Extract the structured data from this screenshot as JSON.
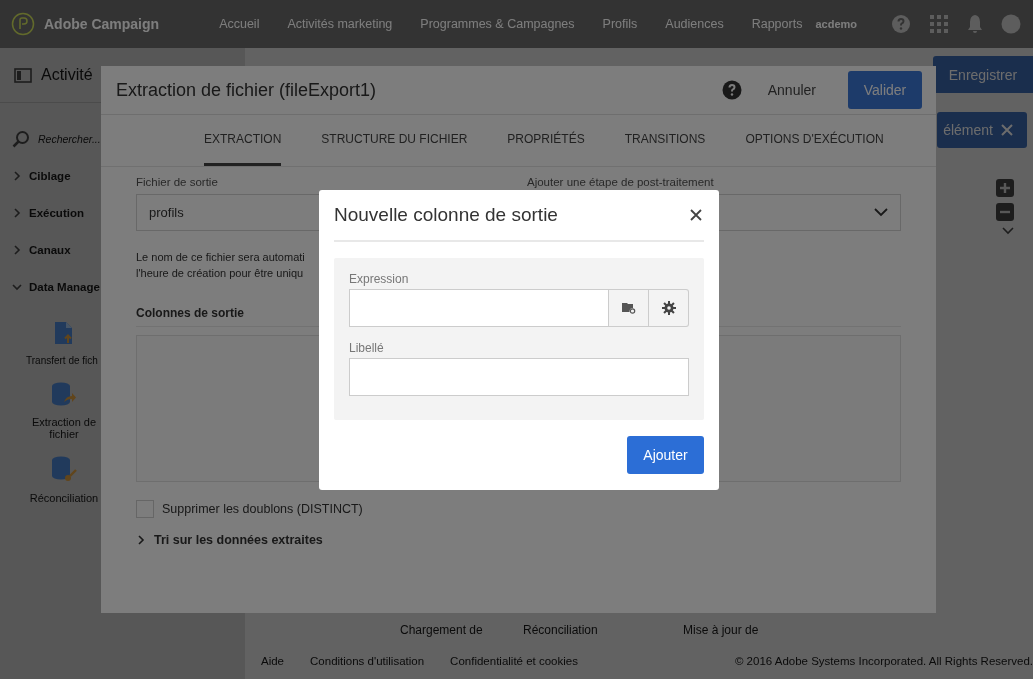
{
  "app_bar": {
    "logo_text": "Adobe Campaign",
    "nav": [
      "Accueil",
      "Activités marketing",
      "Programmes & Campagnes",
      "Profils",
      "Audiences",
      "Rapports"
    ],
    "user": "acdemo"
  },
  "sidebar": {
    "title": "Activité",
    "search": {
      "placeholder": "Rechercher..."
    },
    "groups": [
      {
        "label": "Ciblage",
        "expanded": false
      },
      {
        "label": "Exécution",
        "expanded": false
      },
      {
        "label": "Canaux",
        "expanded": false
      },
      {
        "label": "Data Manage",
        "expanded": true
      }
    ],
    "activities": [
      {
        "label": "Transfert de fich",
        "kind": "transfer"
      },
      {
        "label": "Extraction de fichier",
        "kind": "extract"
      },
      {
        "label": "Réconciliation",
        "kind": "reconcile"
      }
    ]
  },
  "canvas": {
    "save_button": "Enregistrer",
    "filter_chip": "élément",
    "node_labels": [
      "Chargement de",
      "Réconciliation",
      "Mise à jour de"
    ]
  },
  "footer": {
    "links": [
      "Aide",
      "Conditions d'utilisation",
      "Confidentialité et cookies"
    ],
    "copyright": "© 2016 Adobe Systems Incorporated. All Rights Reserved."
  },
  "dialog": {
    "title": "Extraction de fichier (fileExport1)",
    "cancel": "Annuler",
    "confirm": "Valider",
    "tabs": [
      {
        "label": "EXTRACTION",
        "selected": true
      },
      {
        "label": "STRUCTURE DU FICHIER",
        "selected": false
      },
      {
        "label": "PROPRIÉTÉS",
        "selected": false
      },
      {
        "label": "TRANSITIONS",
        "selected": false
      },
      {
        "label": "OPTIONS D'EXÉCUTION",
        "selected": false
      }
    ],
    "output_file": {
      "label": "Fichier de sortie",
      "value": "profils"
    },
    "post_step": {
      "label": "Ajouter une étape de post-traitement"
    },
    "note_lines": [
      "Le nom de ce fichier sera automati",
      "l'heure de création pour être uniqu"
    ],
    "columns_heading": "Colonnes de sortie",
    "distinct": {
      "label": "Supprimer les doublons (DISTINCT)",
      "checked": false
    },
    "sort_section": {
      "label": "Tri sur les données extraites",
      "expanded": false
    }
  },
  "modal": {
    "title": "Nouvelle colonne de sortie",
    "fields": [
      {
        "label": "Expression",
        "kind": "picker"
      },
      {
        "label": "Libellé",
        "kind": "text"
      }
    ],
    "add_button": "Ajouter"
  }
}
